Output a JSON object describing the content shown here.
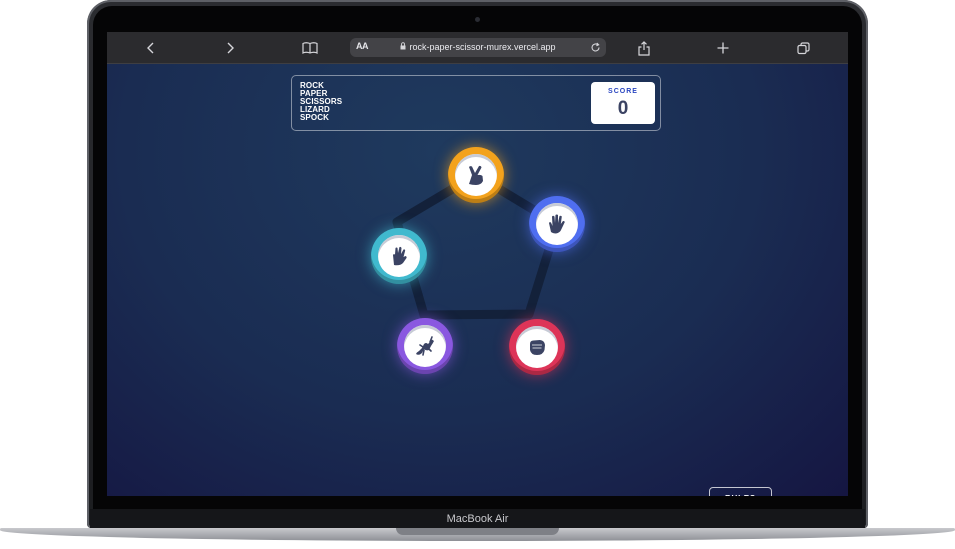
{
  "device": {
    "label": "MacBook Air"
  },
  "browser": {
    "url": "rock-paper-scissor-murex.vercel.app",
    "text_size_label": "AA",
    "icons": [
      "back-icon",
      "forward-icon",
      "bookmarks-icon",
      "lock-icon",
      "reload-icon",
      "share-icon",
      "new-tab-icon",
      "tabs-icon"
    ]
  },
  "game": {
    "title_lines": [
      "ROCK",
      "PAPER",
      "SCISSORS",
      "LIZARD",
      "SPOCK"
    ],
    "score_label": "SCORE",
    "score_value": "0",
    "rules_label": "RULES",
    "choices": [
      {
        "name": "scissors",
        "color": "#f3a21c"
      },
      {
        "name": "paper",
        "color": "#4f6ef0"
      },
      {
        "name": "rock",
        "color": "#dd3458"
      },
      {
        "name": "lizard",
        "color": "#8a58e0"
      },
      {
        "name": "spock",
        "color": "#40b9ce"
      }
    ]
  }
}
